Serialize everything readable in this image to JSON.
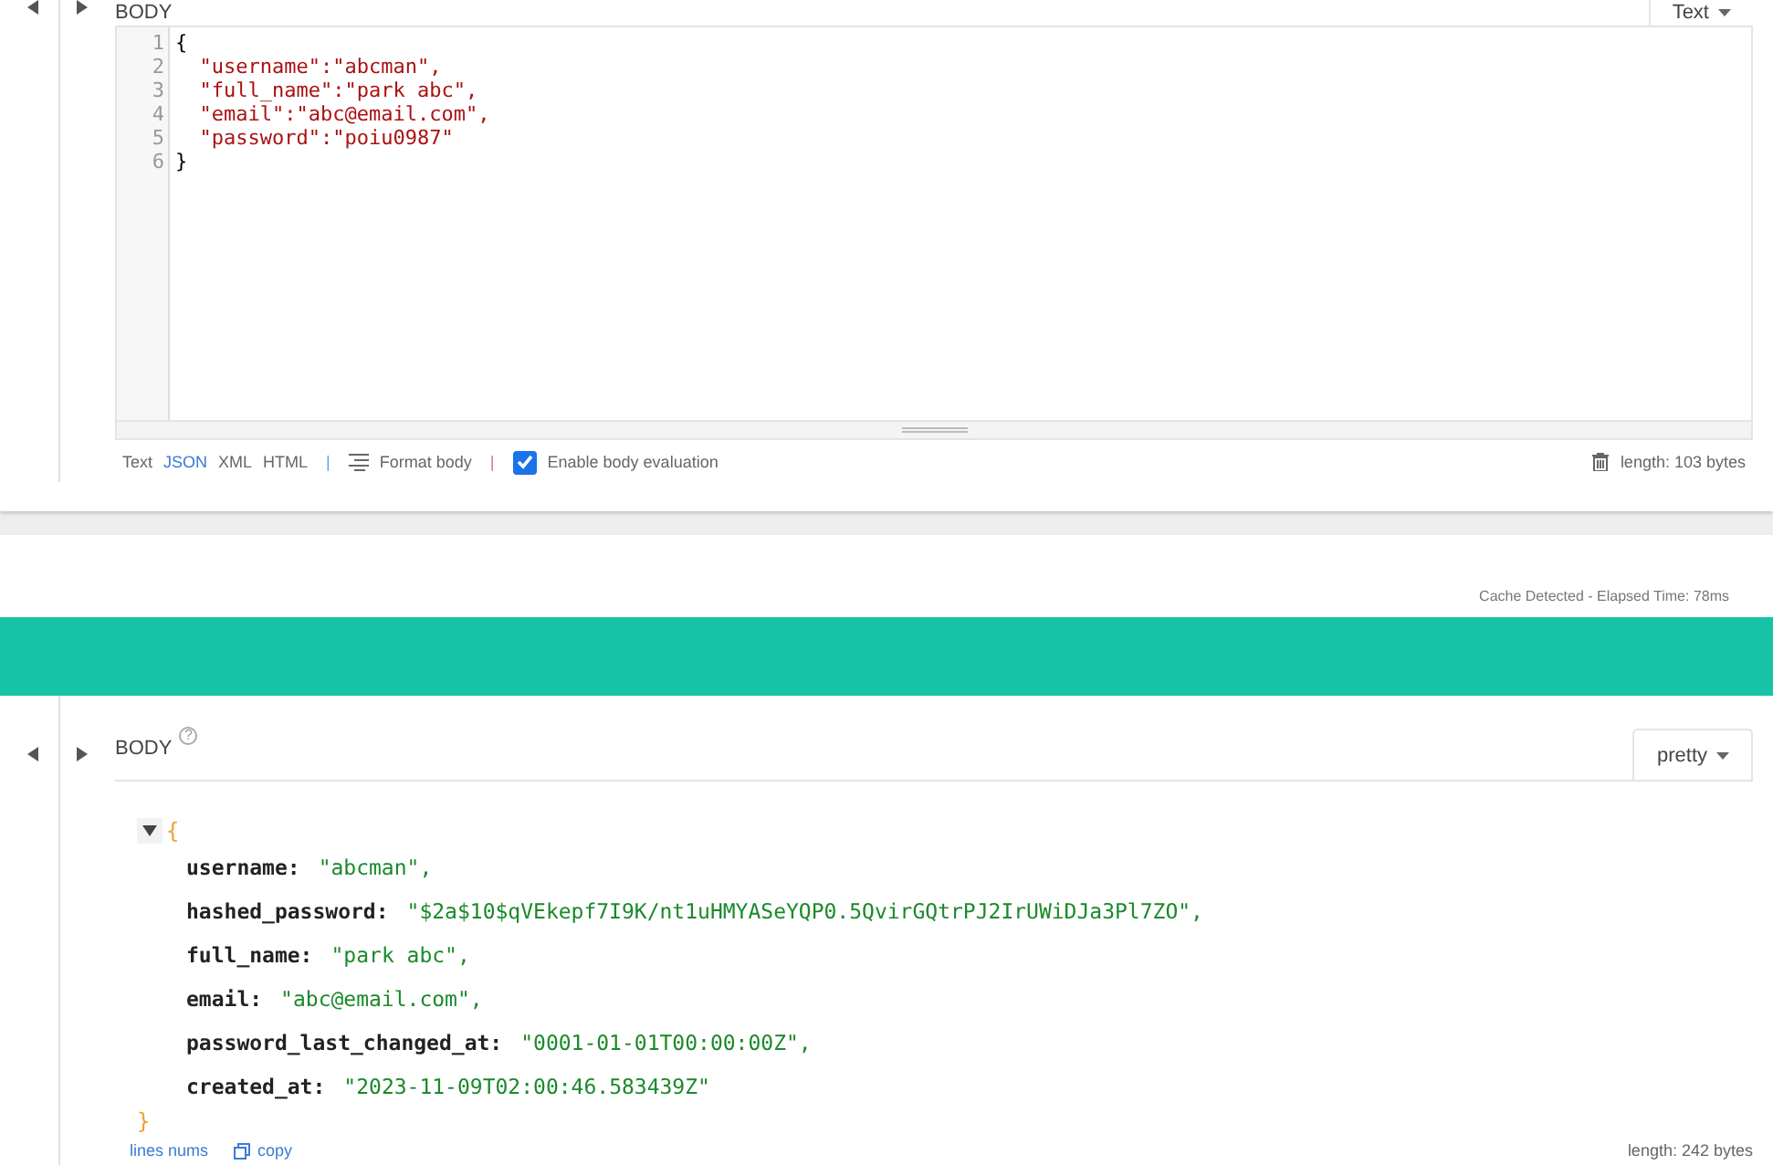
{
  "request": {
    "section_label": "BODY",
    "mode": "Text",
    "editor_lines": [
      {
        "number": "1",
        "kind": "brace",
        "text": "{"
      },
      {
        "number": "2",
        "kind": "entry",
        "text": "  \"username\":\"abcman\","
      },
      {
        "number": "3",
        "kind": "entry",
        "text": "  \"full_name\":\"park abc\","
      },
      {
        "number": "4",
        "kind": "entry",
        "text": "  \"email\":\"abc@email.com\","
      },
      {
        "number": "5",
        "kind": "entry",
        "text": "  \"password\":\"poiu0987\""
      },
      {
        "number": "6",
        "kind": "brace",
        "text": "}"
      }
    ],
    "formats": [
      {
        "label": "Text",
        "selected": false
      },
      {
        "label": "JSON",
        "selected": true
      },
      {
        "label": "XML",
        "selected": false
      },
      {
        "label": "HTML",
        "selected": false
      }
    ],
    "separator": "|",
    "format_body": "Format body",
    "body_evaluation": {
      "label": "Enable body evaluation",
      "checked": true
    },
    "length": "length: 103 bytes"
  },
  "status": "Cache Detected - Elapsed Time: 78ms",
  "response": {
    "section_label": "BODY",
    "help": "?",
    "mode": "pretty",
    "expanded": true,
    "open_brace": "{",
    "close_brace": "}",
    "fields": [
      {
        "key": "username:",
        "value": "\"abcman\","
      },
      {
        "key": "hashed_password:",
        "value": "\"$2a$10$qVEkepf7I9K/nt1uHMYASeYQP0.5QvirGQtrPJ2IrUWiDJa3Pl7ZO\","
      },
      {
        "key": "full_name:",
        "value": "\"park abc\","
      },
      {
        "key": "email:",
        "value": "\"abc@email.com\","
      },
      {
        "key": "password_last_changed_at:",
        "value": "\"0001-01-01T00:00:00Z\","
      },
      {
        "key": "created_at:",
        "value": "\"2023-11-09T02:00:46.583439Z\""
      }
    ],
    "links": [
      "lines nums",
      "copy"
    ],
    "length": "length: 242 bytes"
  }
}
